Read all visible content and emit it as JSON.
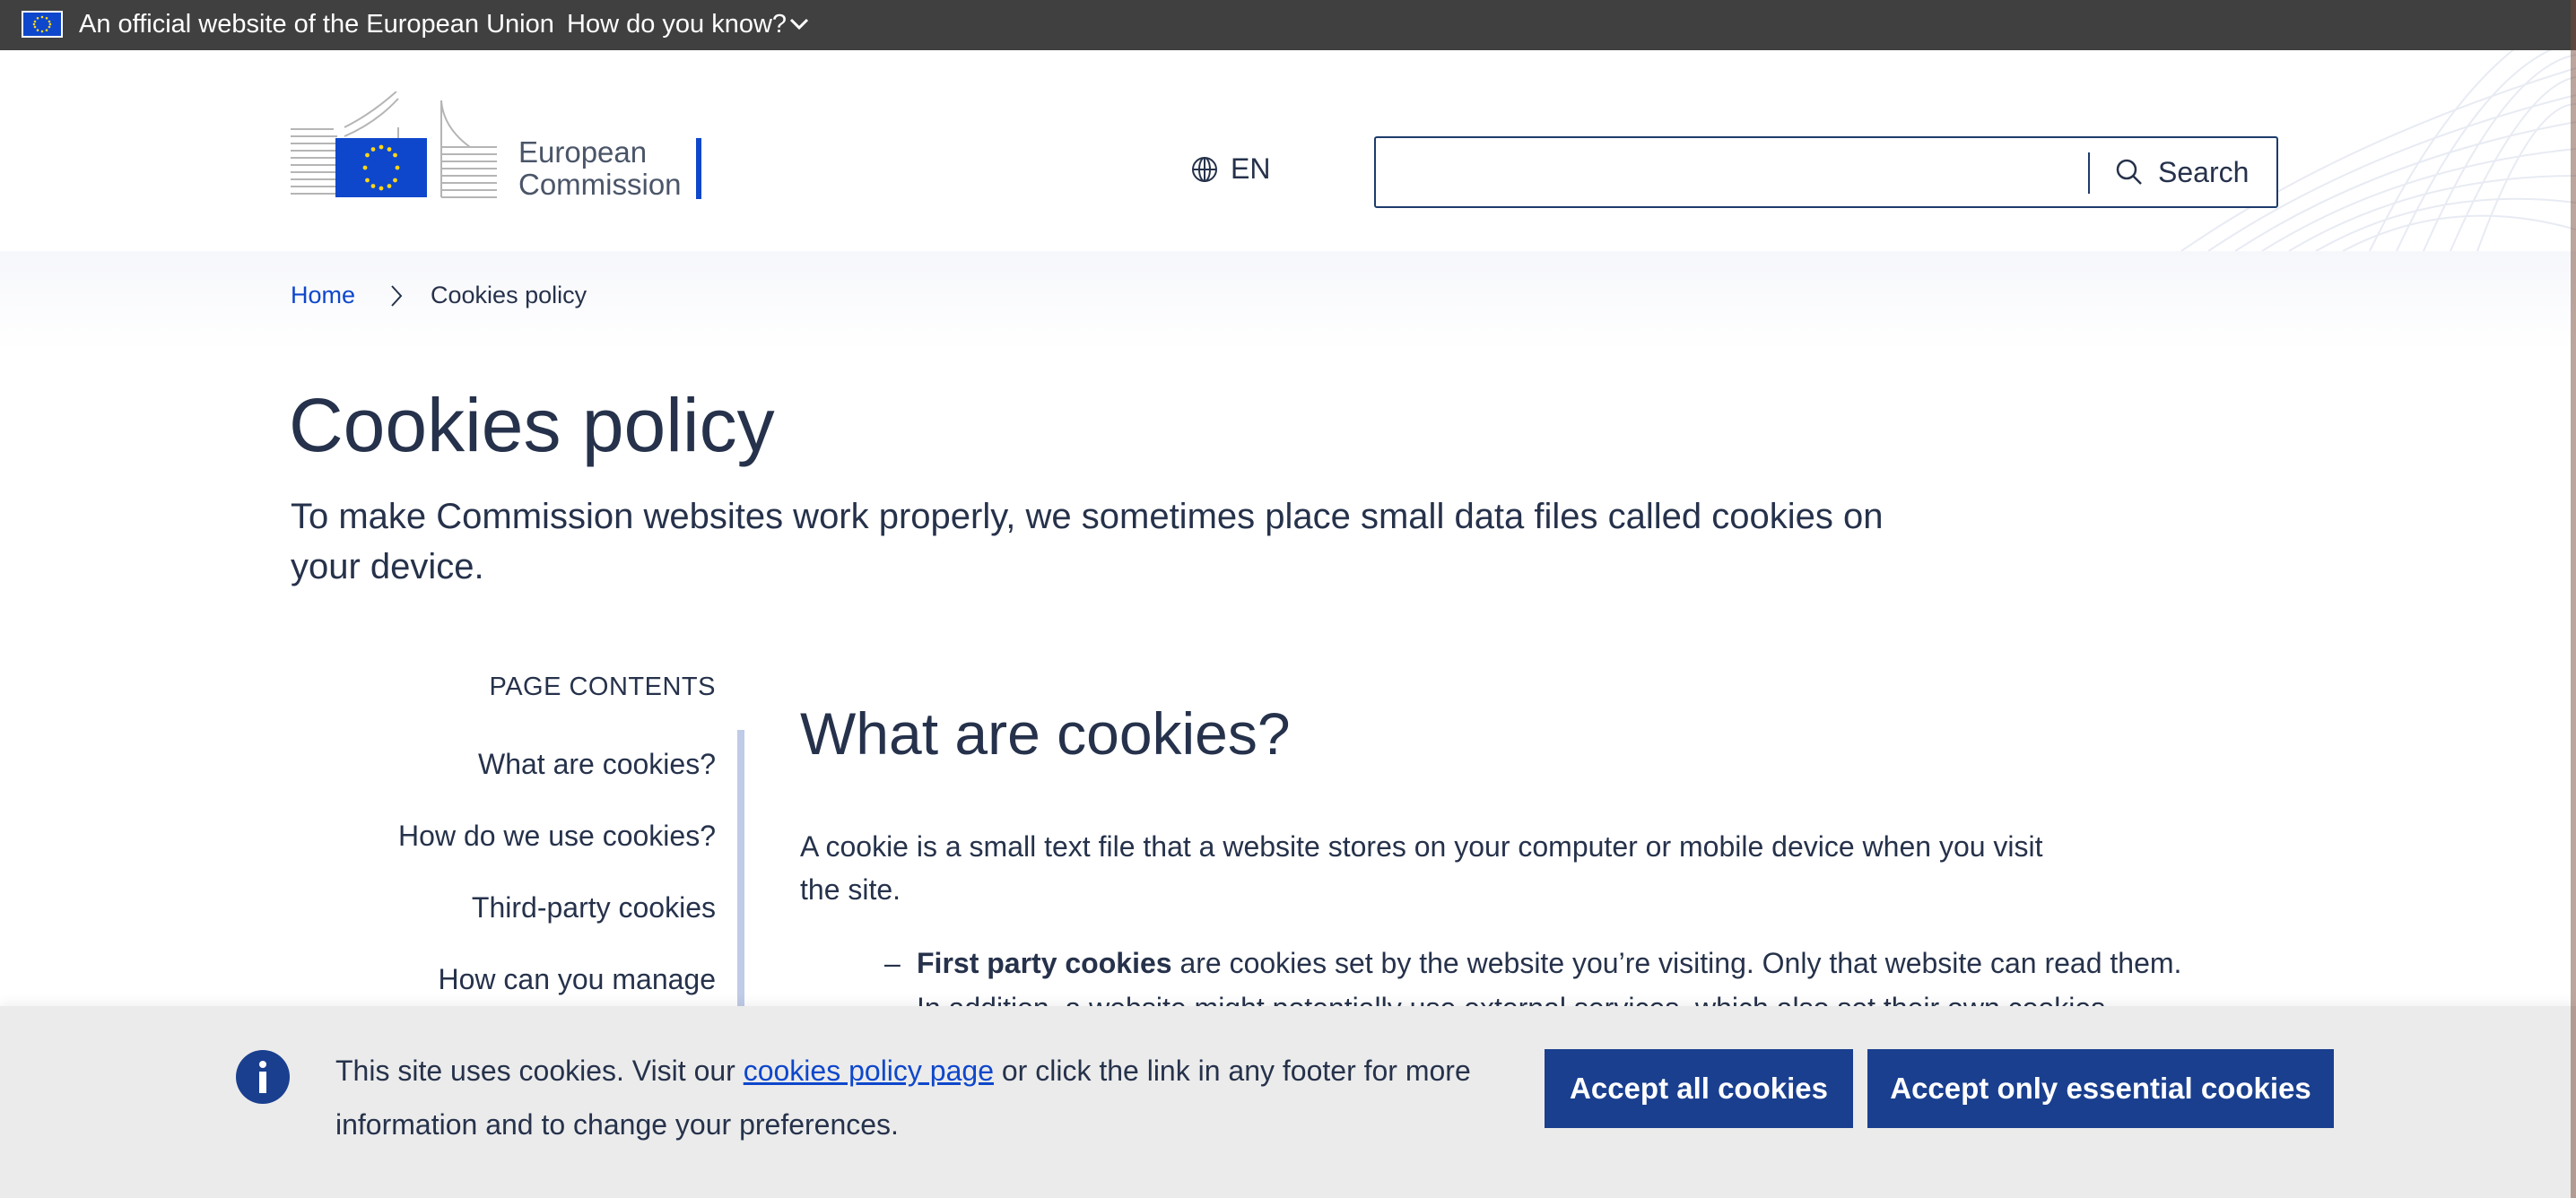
{
  "eu_banner": {
    "official_text": "An official website of the European Union",
    "how_know_label": "How do you know?"
  },
  "header": {
    "logo_line1": "European",
    "logo_line2": "Commission",
    "language": "EN",
    "search_placeholder": "",
    "search_button": "Search"
  },
  "breadcrumb": {
    "home": "Home",
    "current": "Cookies policy"
  },
  "page": {
    "title": "Cookies policy",
    "intro": "To make Commission websites work properly, we sometimes place small data files called cookies on your device."
  },
  "toc": {
    "title": "PAGE CONTENTS",
    "items": [
      "What are cookies?",
      "How do we use cookies?",
      "Third-party cookies",
      "How can you manage"
    ]
  },
  "content": {
    "heading": "What are cookies?",
    "paragraph": "A cookie is a small text file that a website stores on your computer or mobile device when you visit the site.",
    "bullet_dash": "–",
    "bullet_bold": "First party cookies",
    "bullet_rest": " are cookies set by the website you’re visiting. Only that website can read them.",
    "bullet2_partial": "In addition, a website might potentially use external services, which also set their own cookies,"
  },
  "cookie_banner": {
    "text_before": "This site uses cookies. Visit our ",
    "link": "cookies policy page",
    "text_after": " or click the link in any footer for more information and to change your preferences.",
    "accept_all": "Accept all cookies",
    "accept_essential": "Accept only essential cookies"
  },
  "colors": {
    "eu_bar": "#404040",
    "eu_blue": "#0e47cb",
    "button": "#1a3f8f",
    "text": "#26324b",
    "cookie_bg": "#ebebeb"
  }
}
